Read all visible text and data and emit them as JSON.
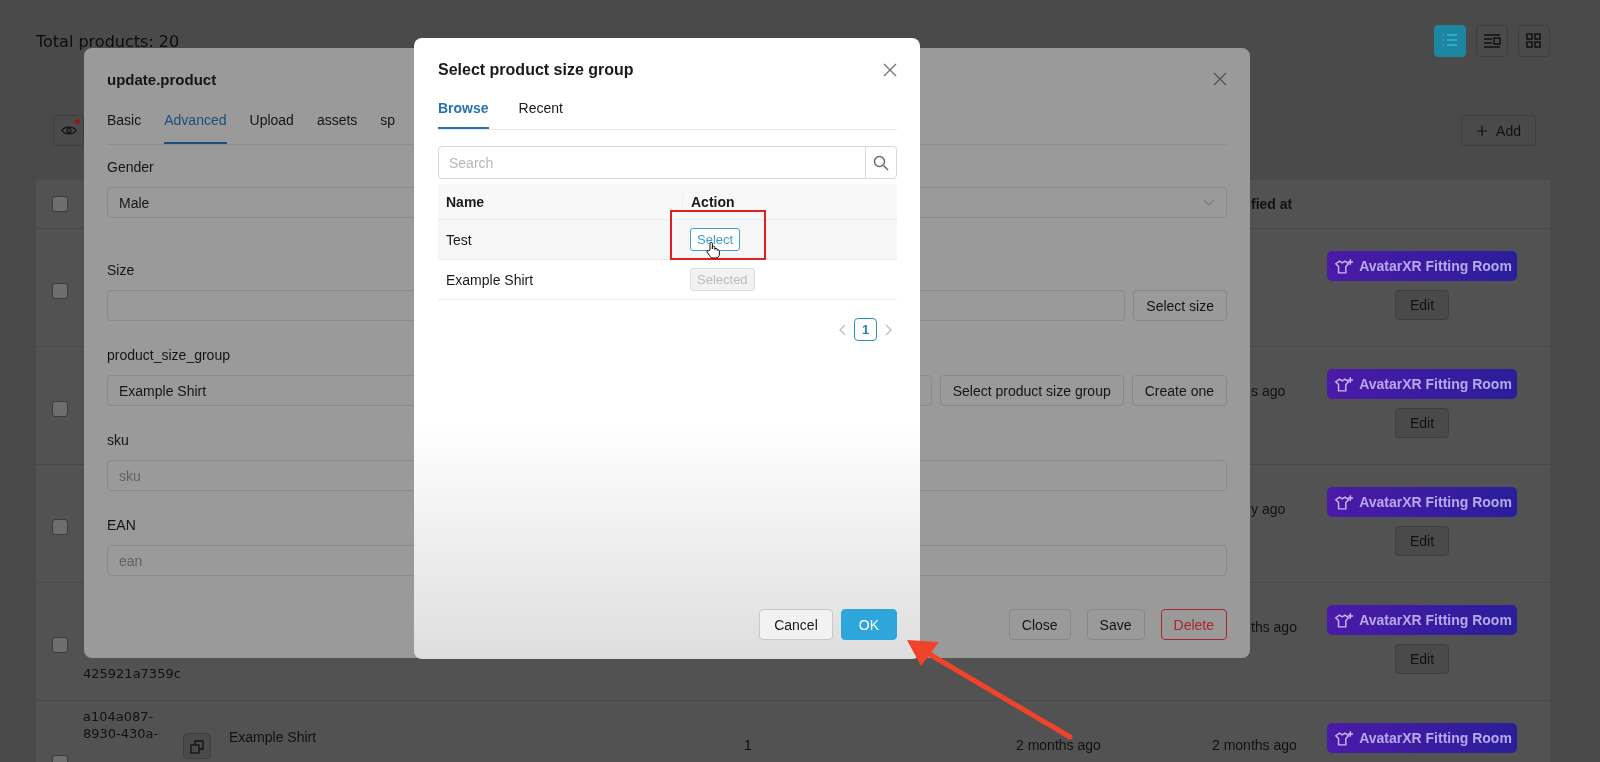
{
  "header": {
    "title": "Total products: 20",
    "view_modes": [
      {
        "kind": "list",
        "selected": true
      },
      {
        "kind": "detail",
        "selected": false
      },
      {
        "kind": "grid",
        "selected": false
      }
    ]
  },
  "toolbar": {
    "add_button": "Add"
  },
  "table": {
    "header": {
      "checked": false,
      "column_6": "fied at"
    },
    "rows": [
      {
        "checked": false,
        "badge": "AvatarXR Fitting Room",
        "action": "Edit"
      },
      {
        "checked": false,
        "column_6": "s ago",
        "badge": "AvatarXR Fitting Room",
        "action": "Edit"
      },
      {
        "checked": false,
        "column_6": "y ago",
        "badge": "AvatarXR Fitting Room",
        "action": "Edit"
      },
      {
        "checked": false,
        "id_tail": "425921a7359c",
        "column_6": "ths ago",
        "badge": "AvatarXR Fitting Room",
        "action": "Edit"
      },
      {
        "checked": false,
        "id_lines": [
          "a104a087-",
          "8930-430a-"
        ],
        "name": "Example Shirt",
        "column_4": "1",
        "created": "2 months ago",
        "modified": "2 months ago",
        "badge": "AvatarXR Fitting Room"
      }
    ]
  },
  "update_dialog": {
    "title": "update.product",
    "tabs": [
      {
        "label": "Basic",
        "selected": false
      },
      {
        "label": "Advanced",
        "selected": true
      },
      {
        "label": "Upload",
        "selected": false
      },
      {
        "label": "assets",
        "selected": false
      },
      {
        "label": "sp",
        "selected": false
      }
    ],
    "fields": [
      {
        "kind": "select",
        "label": "Gender",
        "value": "Male"
      },
      {
        "kind": "input",
        "label": "Size",
        "buttons": [
          "Select size"
        ]
      },
      {
        "kind": "input",
        "label": "product_size_group",
        "value": "Example Shirt",
        "buttons": [
          "Select product size group",
          "Create one"
        ]
      },
      {
        "kind": "input",
        "label": "sku",
        "placeholder": "sku"
      },
      {
        "kind": "input",
        "label": "EAN",
        "placeholder": "ean"
      }
    ],
    "buttons": [
      {
        "label": "Close",
        "kind": "default"
      },
      {
        "label": "Save",
        "kind": "default"
      },
      {
        "label": "Delete",
        "kind": "danger"
      }
    ]
  },
  "size_group_dialog": {
    "title": "Select product size group",
    "tabs": [
      {
        "label": "Browse",
        "selected": true
      },
      {
        "label": "Recent",
        "selected": false
      }
    ],
    "search": {
      "placeholder": "Search"
    },
    "columns": [
      "Name",
      "Action"
    ],
    "rows": [
      {
        "name": "Test",
        "action": "Select",
        "disabled": false,
        "hovered": true
      },
      {
        "name": "Example Shirt",
        "action": "Selected",
        "disabled": true,
        "hovered": false
      }
    ],
    "pagination": {
      "pages": [
        {
          "label": "1",
          "selected": true
        }
      ]
    },
    "buttons": [
      {
        "label": "Cancel",
        "kind": "default"
      },
      {
        "label": "OK",
        "kind": "primary"
      }
    ]
  }
}
